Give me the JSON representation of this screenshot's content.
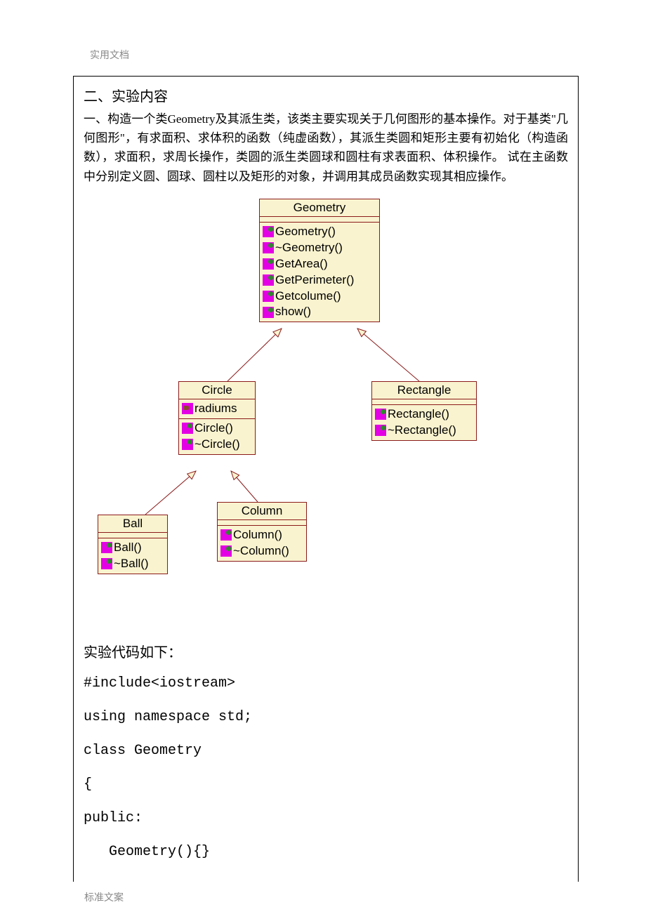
{
  "header": "实用文档",
  "footer": "标准文案",
  "section_title": "二、实验内容",
  "body_text": "一、构造一个类Geometry及其派生类，该类主要实现关于几何图形的基本操作。对于基类\"几何图形\"，有求面积、求体积的函数（纯虚函数），其派生类圆和矩形主要有初始化（构造函数），求面积，求周长操作，类圆的派生类圆球和圆柱有求表面积、体积操作。 试在主函数中分别定义圆、圆球、圆柱以及矩形的对象，并调用其成员函数实现其相应操作。",
  "uml": {
    "geometry": {
      "title": "Geometry",
      "methods": [
        "Geometry()",
        "~Geometry()",
        "GetArea()",
        "GetPerimeter()",
        "Getcolume()",
        "show()"
      ]
    },
    "circle": {
      "title": "Circle",
      "attrs": [
        "radiums"
      ],
      "methods": [
        "Circle()",
        "~Circle()"
      ]
    },
    "rectangle": {
      "title": "Rectangle",
      "methods": [
        "Rectangle()",
        "~Rectangle()"
      ]
    },
    "ball": {
      "title": "Ball",
      "methods": [
        "Ball()",
        "~Ball()"
      ]
    },
    "column": {
      "title": "Column",
      "methods": [
        "Column()",
        "~Column()"
      ]
    }
  },
  "code_label": "实验代码如下：",
  "code_lines": {
    "l0": "#include<iostream>",
    "l1": "using namespace std;",
    "l2": "class Geometry",
    "l3": "{",
    "l4": "public:",
    "l5": "   Geometry(){}"
  }
}
